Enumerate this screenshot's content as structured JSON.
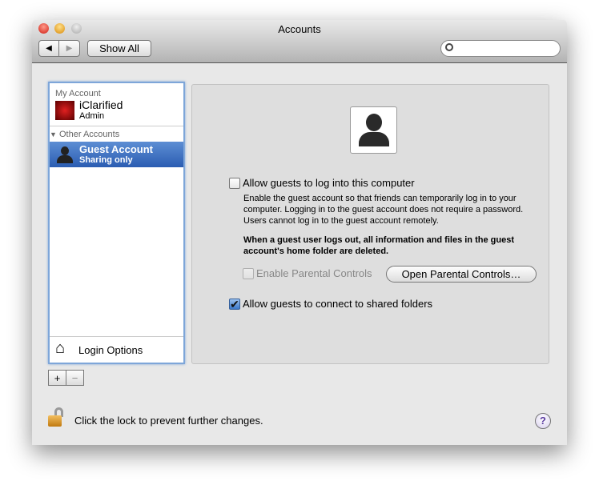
{
  "window": {
    "title": "Accounts"
  },
  "toolbar": {
    "show_all": "Show All",
    "search_placeholder": ""
  },
  "sidebar": {
    "my_account_header": "My Account",
    "my_account": {
      "name": "iClarified",
      "role": "Admin"
    },
    "other_accounts_header": "Other Accounts",
    "other_accounts": [
      {
        "name": "Guest Account",
        "role": "Sharing only",
        "selected": true
      }
    ],
    "login_options": "Login Options",
    "add": "+",
    "remove": "−"
  },
  "main": {
    "allow_login": {
      "label": "Allow guests to log into this computer",
      "checked": false
    },
    "description": "Enable the guest account so that friends can temporarily log in to your computer. Logging in to the guest account does not require a password. Users cannot log in to the guest account remotely.",
    "warning": "When a guest user logs out, all information and files in the guest account's home folder are deleted.",
    "parental": {
      "label": "Enable Parental Controls",
      "checked": false,
      "enabled": false
    },
    "open_parental": "Open Parental Controls…",
    "shared_folders": {
      "label": "Allow guests to connect to shared folders",
      "checked": true
    }
  },
  "footer": {
    "lock_text": "Click the lock to prevent further changes.",
    "help": "?"
  },
  "colors": {
    "selection": "#3a6fc0",
    "focus": "#7ea6d9"
  }
}
